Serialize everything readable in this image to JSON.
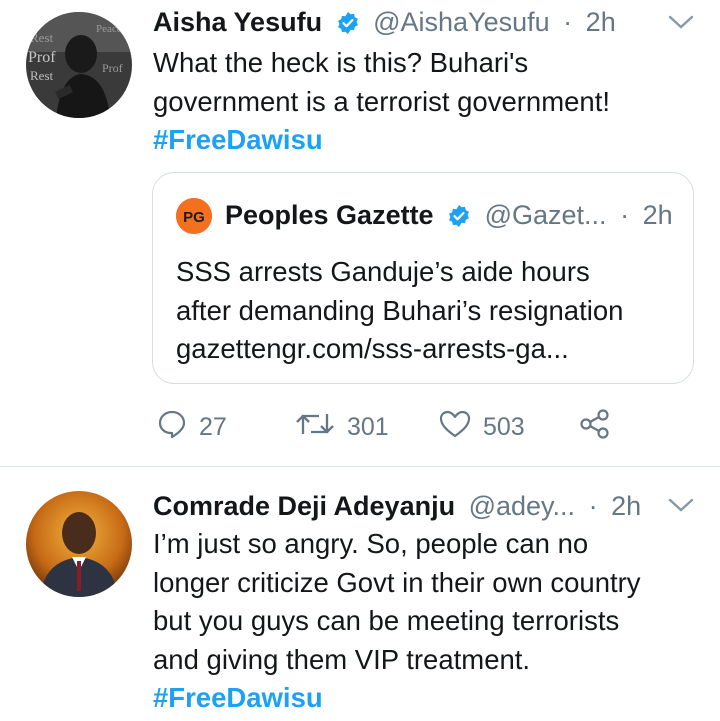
{
  "tweet1": {
    "name": "Aisha Yesufu",
    "handle": "@AishaYesufu",
    "dot": "·",
    "time": "2h",
    "body_lines": [
      "What the heck is this? Buhari's",
      "government is a terrorist government!"
    ],
    "hashtag": "#FreeDawisu",
    "quote": {
      "logo_text": "PG",
      "name": "Peoples Gazette",
      "handle": "@Gazet...",
      "dot": "·",
      "time": "2h",
      "lines": [
        "SSS arrests Ganduje’s aide hours",
        "after demanding Buhari’s resignation",
        "gazettengr.com/sss-arrests-ga..."
      ]
    },
    "actions": {
      "replies": "27",
      "retweets": "301",
      "likes": "503"
    }
  },
  "tweet2": {
    "name": "Comrade Deji Adeyanju",
    "handle": "@adey...",
    "dot": "·",
    "time": "2h",
    "body_lines": [
      "I’m just so angry. So, people can no",
      "longer criticize Govt in their own country",
      "but you guys can be meeting terrorists",
      "and giving them VIP treatment."
    ],
    "hashtag": "#FreeDawisu"
  },
  "colors": {
    "accent": "#1da1f2",
    "secondary_text": "#657786",
    "border": "#e1e8ed",
    "gazette_orange": "#f37021"
  },
  "icons": [
    "verified-badge-icon",
    "chevron-down-icon",
    "reply-icon",
    "retweet-icon",
    "like-icon",
    "share-icon"
  ]
}
